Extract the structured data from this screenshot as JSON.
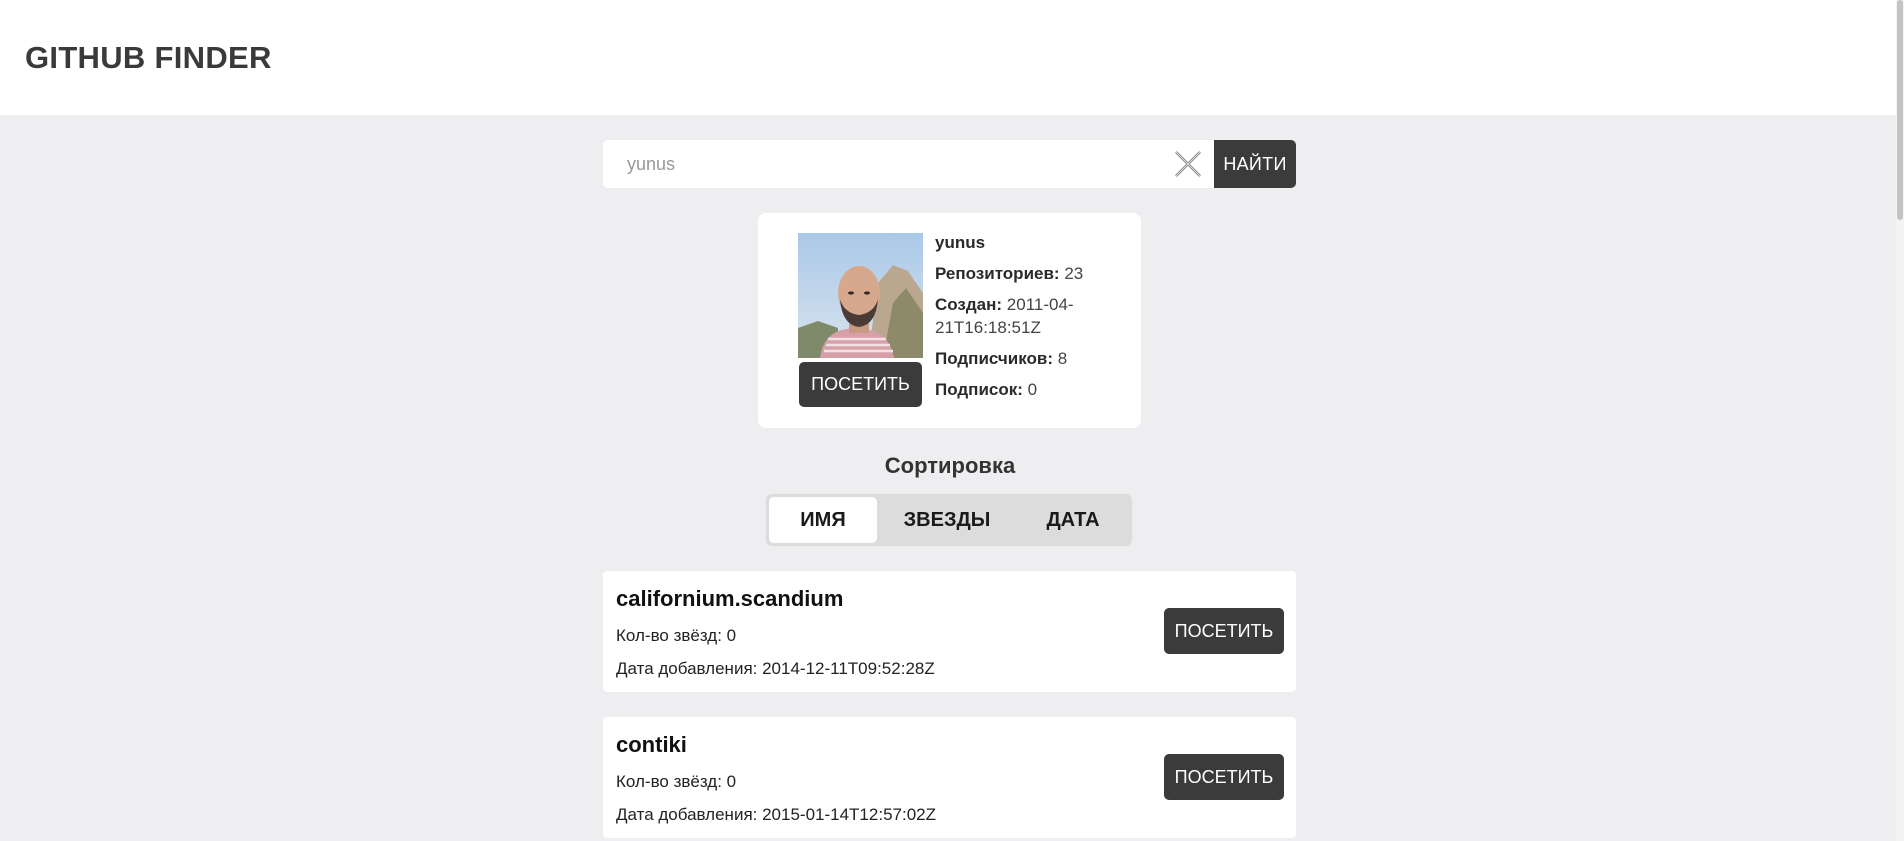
{
  "header": {
    "brand": "GITHUB FINDER"
  },
  "search": {
    "value": "yunus",
    "button_label": "НАЙТИ",
    "clear_icon": "close-icon"
  },
  "profile": {
    "login": "yunus",
    "repos_label": "Репозиториев:",
    "repos_value": "23",
    "created_label": "Создан:",
    "created_value": "2011-04-21T16:18:51Z",
    "followers_label": "Подписчиков:",
    "followers_value": "8",
    "following_label": "Подписок:",
    "following_value": "0",
    "visit_label": "ПОСЕТИТЬ"
  },
  "sort": {
    "title": "Сортировка",
    "options": [
      {
        "label": "ИМЯ",
        "active": true
      },
      {
        "label": "ЗВЕЗДЫ",
        "active": false
      },
      {
        "label": "ДАТА",
        "active": false
      }
    ]
  },
  "repos": [
    {
      "name": "californium.scandium",
      "stars_text": "Кол-во звёзд: 0",
      "date_text": "Дата добавления: 2014-12-11T09:52:28Z",
      "visit_label": "ПОСЕТИТЬ"
    },
    {
      "name": "contiki",
      "stars_text": "Кол-во звёзд: 0",
      "date_text": "Дата добавления: 2015-01-14T12:57:02Z",
      "visit_label": "ПОСЕТИТЬ"
    }
  ],
  "colors": {
    "page_bg": "#eeeef0",
    "button_dark": "#3b3b3b",
    "card_bg": "#ffffff"
  }
}
